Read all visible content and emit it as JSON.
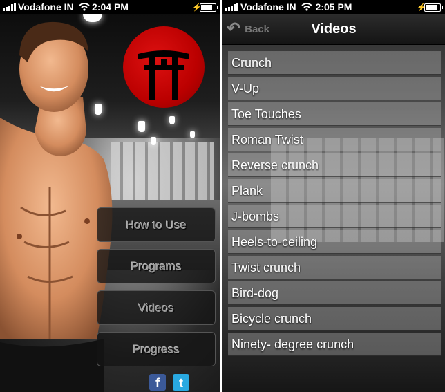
{
  "left_screen": {
    "status_bar": {
      "carrier": "Vodafone IN",
      "time": "2:04 PM"
    },
    "menu": [
      {
        "label": "How to Use"
      },
      {
        "label": "Programs"
      },
      {
        "label": "Videos"
      },
      {
        "label": "Progress"
      }
    ],
    "social": [
      {
        "icon": "facebook-icon",
        "glyph": "f",
        "color": "#3b5998"
      },
      {
        "icon": "twitter-icon",
        "glyph": "t",
        "color": "#29a9e1"
      }
    ],
    "logo_color": "#c40000"
  },
  "right_screen": {
    "status_bar": {
      "carrier": "Vodafone IN",
      "time": "2:05 PM"
    },
    "nav": {
      "back_label": "Back",
      "title": "Videos"
    },
    "videos": [
      "Crunch",
      "V-Up",
      "Toe Touches",
      "Roman Twist",
      "Reverse crunch",
      "Plank",
      "J-bombs",
      "Heels-to-ceiling",
      "Twist crunch",
      "Bird-dog",
      "Bicycle crunch",
      "Ninety- degree crunch"
    ]
  }
}
